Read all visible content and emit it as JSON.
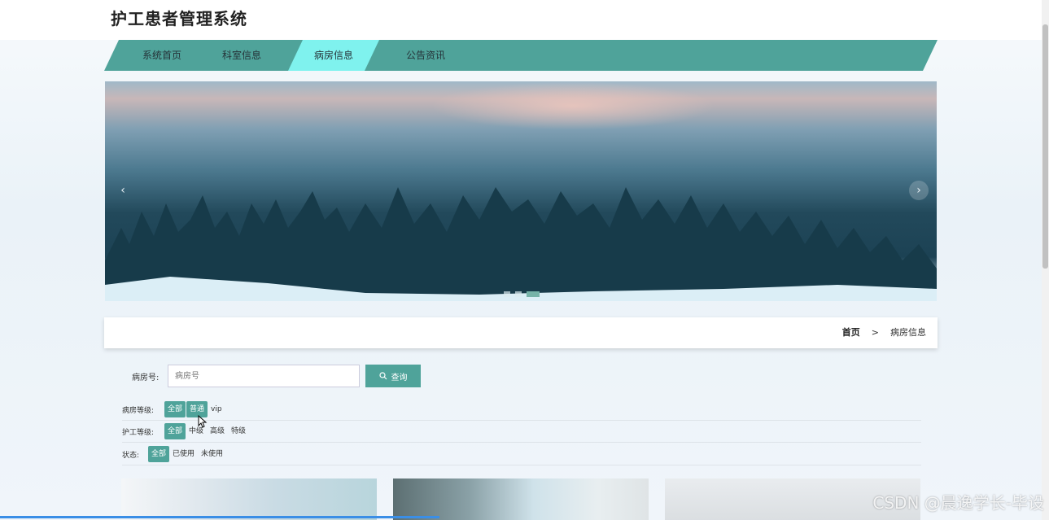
{
  "header": {
    "title": "护工患者管理系统"
  },
  "nav": {
    "items": [
      {
        "label": "系统首页"
      },
      {
        "label": "科室信息"
      },
      {
        "label": "病房信息"
      },
      {
        "label": "公告资讯"
      }
    ],
    "active_index": 2
  },
  "banner": {
    "prev_label": "‹",
    "next_label": "›",
    "slide_count": 3,
    "active_slide": 3
  },
  "breadcrumb": {
    "home": "首页",
    "separator": ">",
    "current": "病房信息"
  },
  "search": {
    "label": "病房号:",
    "placeholder": "病房号",
    "button_label": "查询",
    "button_icon": "search-icon"
  },
  "filters": [
    {
      "label": "病房等级:",
      "options": [
        "全部",
        "普通",
        "vip"
      ],
      "selected": [
        0,
        1
      ]
    },
    {
      "label": "护工等级:",
      "options": [
        "全部",
        "中级",
        "高级",
        "特级"
      ],
      "selected": [
        0
      ]
    },
    {
      "label": "状态:",
      "options": [
        "全部",
        "已使用",
        "未使用"
      ],
      "selected": [
        0
      ]
    }
  ],
  "watermark": "CSDN @晨逸学长-毕设",
  "colors": {
    "accent": "#4fa39a",
    "nav_active": "#7ff2ee"
  }
}
